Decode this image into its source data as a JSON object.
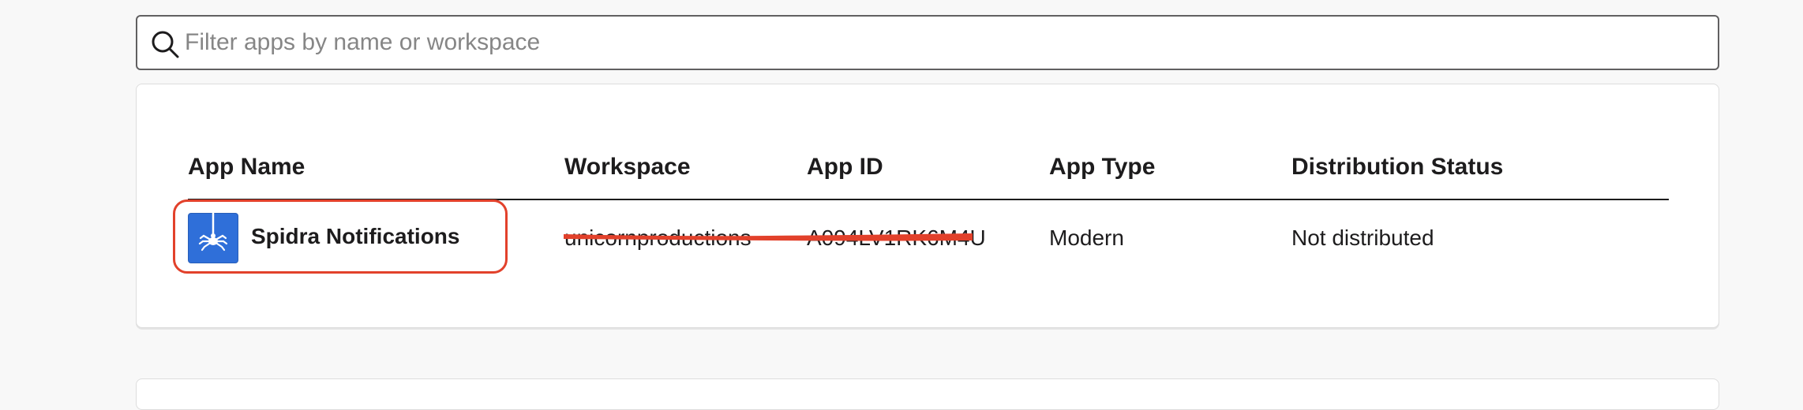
{
  "search": {
    "placeholder": "Filter apps by name or workspace",
    "icon": "search-icon"
  },
  "table": {
    "headers": [
      "App Name",
      "Workspace",
      "App ID",
      "App Type",
      "Distribution Status"
    ],
    "rows": [
      {
        "app_name": "Spidra Notifications",
        "app_icon": "spider-app-icon",
        "workspace": "unicornproductions",
        "app_id": "A094LV1RK6M4U",
        "app_type": "Modern",
        "distribution_status": "Not distributed"
      }
    ]
  },
  "annotations": {
    "highlight_color": "#e2412b",
    "redaction_color": "#e2412b"
  },
  "colors": {
    "page_bg": "#f8f8f8",
    "card_bg": "#ffffff",
    "text": "#1d1c1d",
    "placeholder": "#868686",
    "app_icon_bg": "#2f6fd9"
  }
}
